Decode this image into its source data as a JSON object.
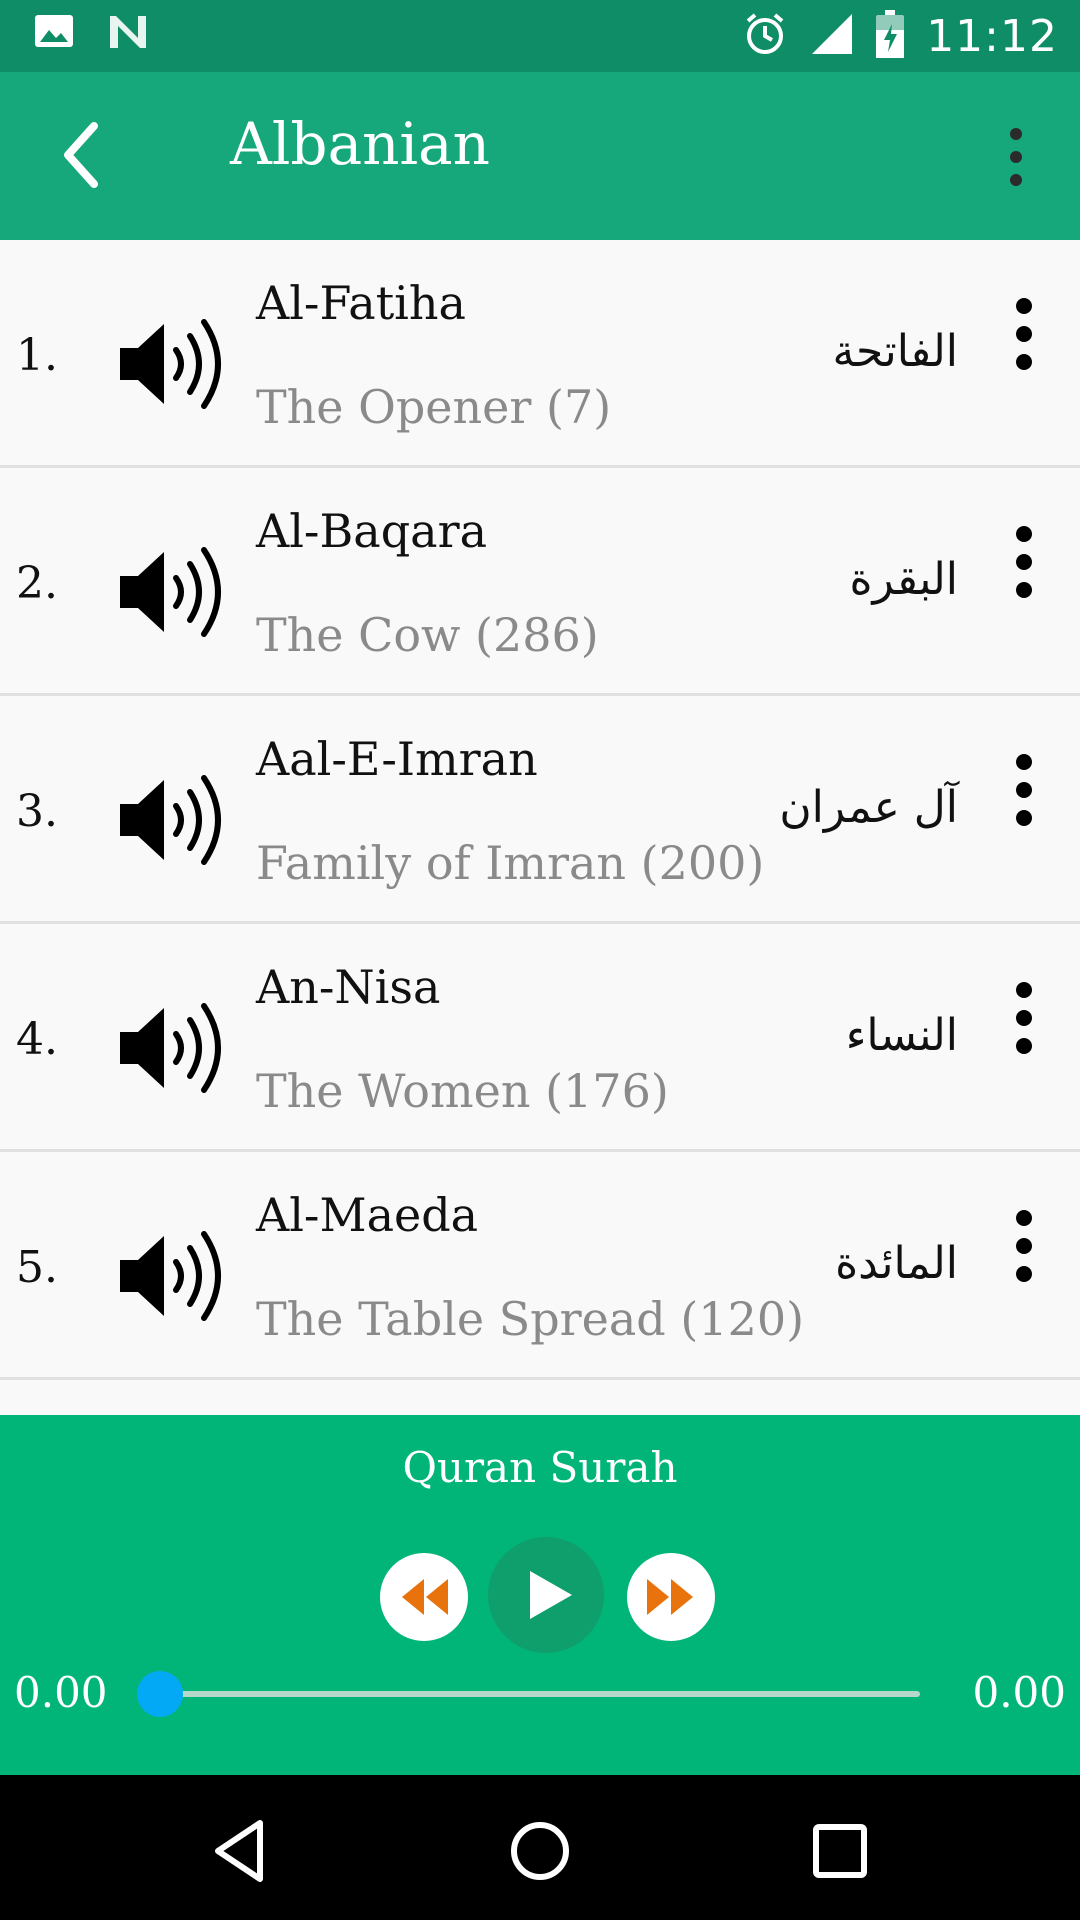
{
  "status_bar": {
    "time": "11:12",
    "left_icons": [
      "image-icon",
      "n-icon"
    ],
    "right_icons": [
      "alarm-icon",
      "signal-icon",
      "battery-charging-icon"
    ]
  },
  "app_bar": {
    "title": "Albanian",
    "back_icon": "chevron-left-icon",
    "menu_icon": "more-vert-icon"
  },
  "surahs": [
    {
      "number": "1.",
      "title": "Al-Fatiha",
      "subtitle": "The Opener (7)",
      "arabic": "الفاتحة"
    },
    {
      "number": "2.",
      "title": "Al-Baqara",
      "subtitle": "The Cow (286)",
      "arabic": "البقرة"
    },
    {
      "number": "3.",
      "title": "Aal-E-Imran",
      "subtitle": "Family of Imran (200)",
      "arabic": "آل عمران"
    },
    {
      "number": "4.",
      "title": "An-Nisa",
      "subtitle": "The Women (176)",
      "arabic": "النساء"
    },
    {
      "number": "5.",
      "title": "Al-Maeda",
      "subtitle": "The Table Spread (120)",
      "arabic": "المائدة"
    }
  ],
  "player": {
    "title": "Quran Surah",
    "time_elapsed": "0.00",
    "time_total": "0.00",
    "progress": 0,
    "accent_color": "#00b577",
    "seek_color": "#03a9f4",
    "control_color": "#e8730c"
  },
  "colors": {
    "status_bar": "#0f8d67",
    "app_bar": "#16a87a"
  }
}
